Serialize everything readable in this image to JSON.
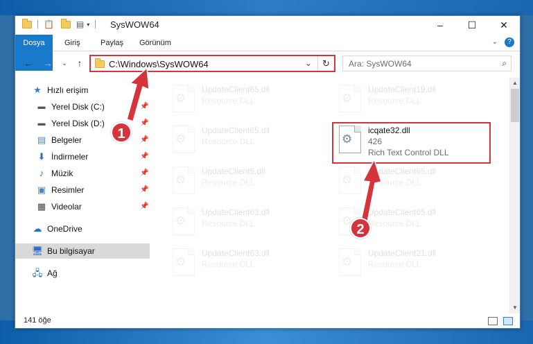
{
  "window": {
    "title": "SysWOW64",
    "controls": {
      "minimize": "–",
      "maximize": "☐",
      "close": "✕"
    }
  },
  "ribbon": {
    "tabs": [
      "Dosya",
      "Giriş",
      "Paylaş",
      "Görünüm"
    ]
  },
  "address_bar": {
    "path": "C:\\Windows\\SysWOW64"
  },
  "search": {
    "placeholder": "Ara: SysWOW64"
  },
  "sidebar": {
    "quick_access": "Hızlı erişim",
    "items": [
      {
        "label": "Yerel Disk (C:)",
        "icon": "drive-icon"
      },
      {
        "label": "Yerel Disk (D:)",
        "icon": "drive-icon"
      },
      {
        "label": "Belgeler",
        "icon": "documents-icon"
      },
      {
        "label": "İndirmeler",
        "icon": "download-icon"
      },
      {
        "label": "Müzik",
        "icon": "music-icon"
      },
      {
        "label": "Resimler",
        "icon": "pictures-icon"
      },
      {
        "label": "Videolar",
        "icon": "video-icon"
      }
    ],
    "onedrive": "OneDrive",
    "this_pc": "Bu bilgisayar",
    "network": "Ağ"
  },
  "files": [
    {
      "name": "UpdateClient65.dll",
      "desc": "Resource DLL",
      "faded": true
    },
    {
      "name": "UpdateClient19.dll",
      "desc": "Resource DLL",
      "faded": true
    },
    {
      "name": "UpdateClient65.dll",
      "desc": "Resource DLL",
      "faded": true
    },
    {
      "name": "icqate32.dll",
      "version": "426",
      "desc": "Rich Text Control DLL",
      "faded": false
    },
    {
      "name": "UpdateClient5.dll",
      "desc": "Resource DLL",
      "faded": true
    },
    {
      "name": "UpdateClient65.dll",
      "desc": "Resource DLL",
      "faded": true
    },
    {
      "name": "UpdateClient63.dll",
      "desc": "Resource DLL",
      "faded": true
    },
    {
      "name": "UpdateClient65.dll",
      "desc": "Resource DLL",
      "faded": true
    },
    {
      "name": "UpdateClient63.dll",
      "desc": "Resource DLL",
      "faded": true
    },
    {
      "name": "UpdateClient21.dll",
      "desc": "Resource DLL",
      "faded": true
    }
  ],
  "status": {
    "count": "141 öğe"
  },
  "annotations": {
    "step1": "1",
    "step2": "2",
    "color": "#d5343a"
  }
}
